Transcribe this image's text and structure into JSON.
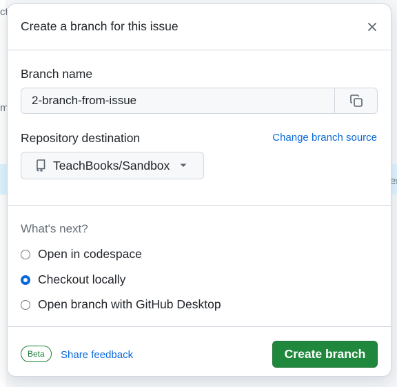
{
  "background": {
    "fragment_top_left": "ct",
    "fragment_mid_left": "m",
    "fragment_right": "er"
  },
  "dialog": {
    "title": "Create a branch for this issue",
    "close_icon": "close-icon"
  },
  "branch": {
    "label": "Branch name",
    "value": "2-branch-from-issue",
    "copy_icon": "copy-icon"
  },
  "repository": {
    "label": "Repository destination",
    "change_source_link": "Change branch source",
    "selected_repo": "TeachBooks/Sandbox",
    "repo_icon": "repo-icon",
    "caret_icon": "triangle-down-icon"
  },
  "next": {
    "label": "What's next?",
    "options": [
      {
        "label": "Open in codespace",
        "checked": false
      },
      {
        "label": "Checkout locally",
        "checked": true
      },
      {
        "label": "Open branch with GitHub Desktop",
        "checked": false
      }
    ]
  },
  "footer": {
    "badge": "Beta",
    "feedback_link": "Share feedback",
    "create_button": "Create branch"
  },
  "colors": {
    "accent": "#0969da",
    "primary_button": "#1f883d",
    "beta_badge": "#1a7f37",
    "border": "#d0d7de"
  }
}
